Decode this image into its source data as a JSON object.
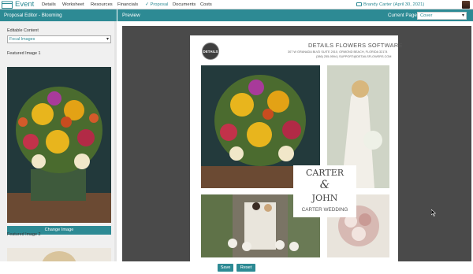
{
  "app": {
    "title": "Event",
    "nav": [
      {
        "label": "Details",
        "active": false
      },
      {
        "label": "Worksheet",
        "active": false
      },
      {
        "label": "Resources",
        "active": false
      },
      {
        "label": "Financials",
        "active": false
      },
      {
        "label": "Proposal",
        "active": true
      },
      {
        "label": "Documents",
        "active": false
      },
      {
        "label": "Costs",
        "active": false
      }
    ],
    "user": "Brandy Carter (April 30, 2021)",
    "accent": "#2d8a94"
  },
  "editor": {
    "header": "Proposal Editor - Blooming",
    "editable_content_label": "Editable Content",
    "editable_content_value": "Focal Images",
    "featured_image_1_label": "Featured Image 1",
    "change_image_label": "Change Image",
    "featured_image_2_label": "Featured Image 2"
  },
  "preview": {
    "header": "Preview",
    "current_page_label": "Current Page:",
    "current_page_value": "Cover"
  },
  "sheet": {
    "company": "DETAILS FLOWERS SOFTWARE",
    "address": "307 W GRANADA BLVD SUITE 2010, ORMOND BEACH, FLORIDA 32174",
    "contact": "(386) 255-9594 | SUPPORT@DETAILSFLOWERS.COM",
    "badge": "DETAILS",
    "name1": "CARTER",
    "amp": "&",
    "name2": "JOHN",
    "subtitle": "CARTER WEDDING"
  },
  "footer": {
    "save_label": "Save",
    "reset_label": "Reset"
  }
}
